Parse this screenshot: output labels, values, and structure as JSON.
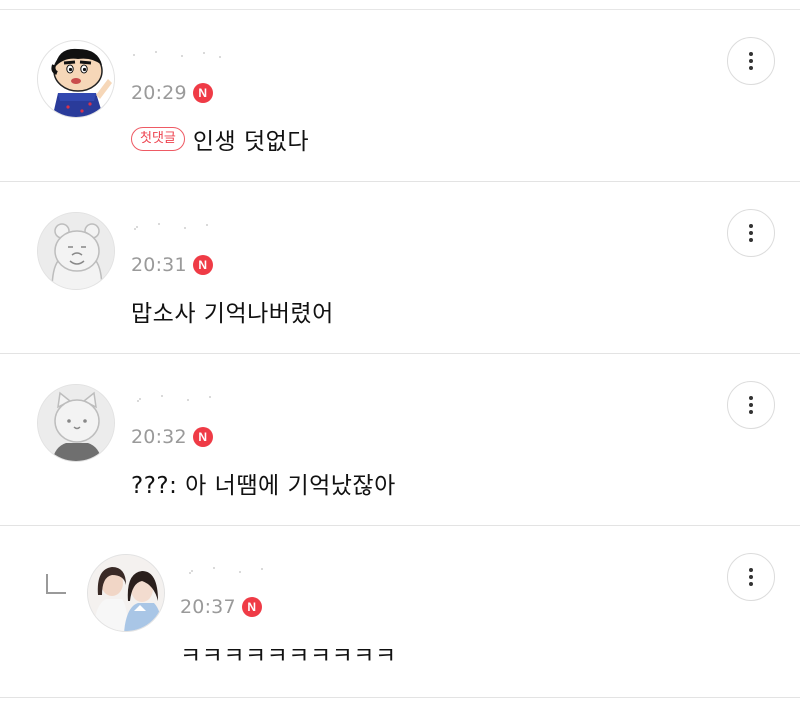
{
  "comments": [
    {
      "avatar_icon": "cartoon-boy-avatar",
      "time": "20:29",
      "new_badge": "N",
      "first_comment_badge": "첫댓글",
      "text": "인생 덧없다"
    },
    {
      "avatar_icon": "bear-avatar",
      "time": "20:31",
      "new_badge": "N",
      "text": "맙소사 기억나버렸어"
    },
    {
      "avatar_icon": "cat-avatar",
      "time": "20:32",
      "new_badge": "N",
      "text": "???: 아 너땜에 기억났잖아"
    },
    {
      "avatar_icon": "two-girls-photo-avatar",
      "is_reply": true,
      "time": "20:37",
      "new_badge": "N",
      "text": "ㅋㅋㅋㅋㅋㅋㅋㅋㅋㅋ"
    }
  ],
  "colors": {
    "new_badge": "#ef3b46",
    "first_badge": "#ee4450",
    "time": "#9a9a9a",
    "text": "#111111",
    "divider": "#e3e3e3"
  }
}
